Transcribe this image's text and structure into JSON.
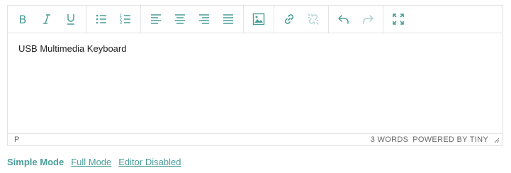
{
  "colors": {
    "accent": "#4a9d98",
    "border": "#e3e3e3",
    "text": "#222222",
    "status_text": "#666666"
  },
  "toolbar": {
    "groups": [
      [
        {
          "icon": "bold-icon"
        },
        {
          "icon": "italic-icon"
        },
        {
          "icon": "underline-icon"
        }
      ],
      [
        {
          "icon": "bullet-list-icon"
        },
        {
          "icon": "numbered-list-icon"
        }
      ],
      [
        {
          "icon": "align-left-icon"
        },
        {
          "icon": "align-center-icon"
        },
        {
          "icon": "align-right-icon"
        },
        {
          "icon": "align-justify-icon"
        }
      ],
      [
        {
          "icon": "image-icon"
        }
      ],
      [
        {
          "icon": "link-icon"
        },
        {
          "icon": "unlink-icon",
          "disabled": true
        }
      ],
      [
        {
          "icon": "undo-icon"
        },
        {
          "icon": "redo-icon",
          "disabled": true
        }
      ],
      [
        {
          "icon": "fullscreen-icon"
        }
      ]
    ]
  },
  "editor": {
    "content": "USB Multimedia Keyboard"
  },
  "statusbar": {
    "path": "P",
    "word_count": "3 WORDS",
    "powered_by": "POWERED BY TINY"
  },
  "modes": {
    "simple": "Simple Mode",
    "full": "Full Mode",
    "disabled": "Editor Disabled"
  }
}
